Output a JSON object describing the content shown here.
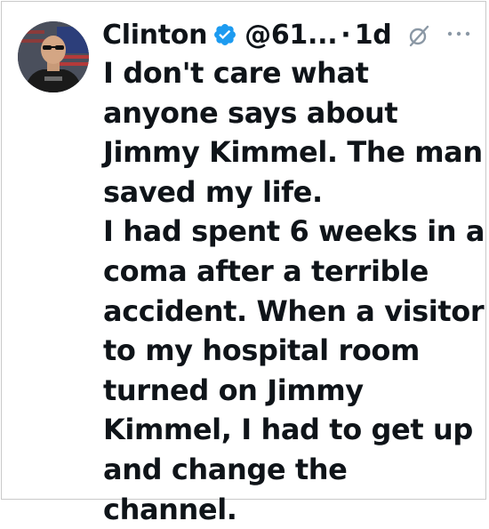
{
  "tweet": {
    "author_name": "Clinton",
    "handle": "@61...",
    "separator": "·",
    "timestamp": "1d",
    "verified": true,
    "accent_color": "#1d9bf0",
    "text": "I don't care what anyone says about Jimmy Kimmel. The man saved my life.\nI had spent 6 weeks in a coma after a terrible accident. When a visitor to my hospital room turned on Jimmy Kimmel, I had to get up and change the channel."
  },
  "icons": {
    "verified": "verified-badge-icon",
    "grok": "grok-icon",
    "more": "more-options-icon"
  }
}
